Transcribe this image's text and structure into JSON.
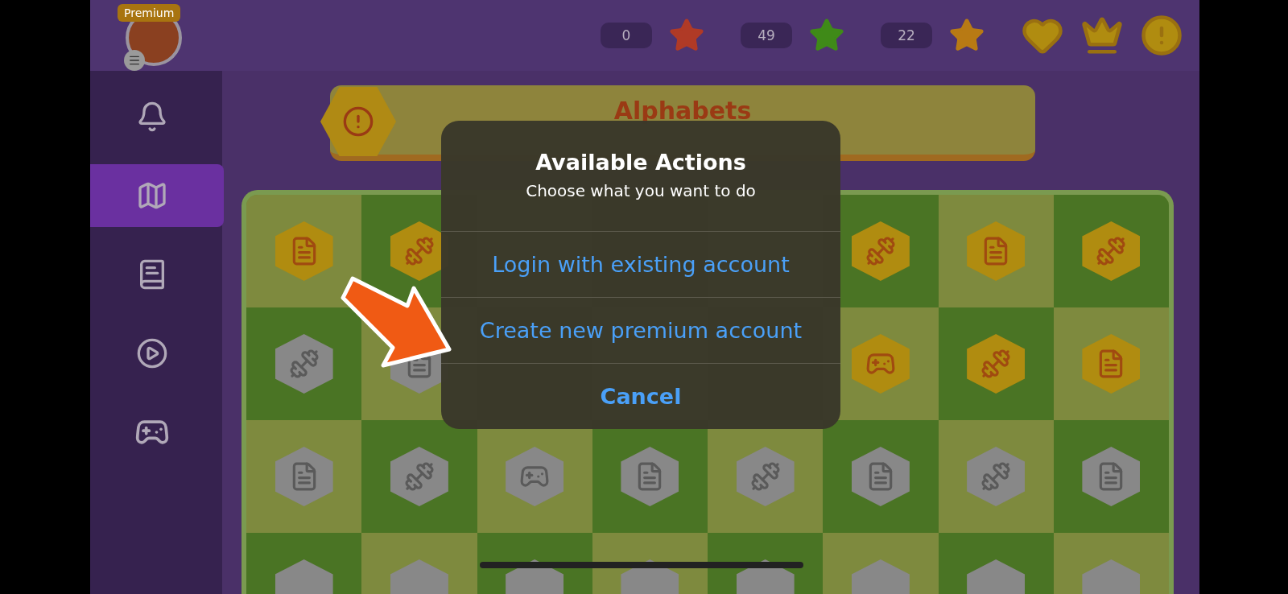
{
  "profile": {
    "badge": "Premium"
  },
  "stats": [
    {
      "count": "0",
      "color": "#b03a26"
    },
    {
      "count": "49",
      "color": "#3f8a18"
    },
    {
      "count": "22",
      "color": "#b87a14"
    }
  ],
  "sidebar": {
    "items": [
      {
        "kind": "bell",
        "selected": false
      },
      {
        "kind": "map",
        "selected": true
      },
      {
        "kind": "book",
        "selected": false
      },
      {
        "kind": "play",
        "selected": false
      },
      {
        "kind": "gamepad",
        "selected": false
      }
    ]
  },
  "banner": {
    "title": "Alphabets"
  },
  "map": {
    "rows": [
      [
        {
          "kind": "doc",
          "unlocked": true
        },
        {
          "kind": "dumbbell",
          "unlocked": true
        },
        null,
        null,
        null,
        {
          "kind": "dumbbell",
          "unlocked": true
        },
        {
          "kind": "doc",
          "unlocked": true
        },
        {
          "kind": "dumbbell",
          "unlocked": true
        }
      ],
      [
        {
          "kind": "dumbbell",
          "unlocked": false
        },
        {
          "kind": "doc",
          "unlocked": false
        },
        null,
        null,
        null,
        {
          "kind": "gamepad",
          "unlocked": true
        },
        {
          "kind": "dumbbell",
          "unlocked": true
        },
        {
          "kind": "doc",
          "unlocked": true
        }
      ],
      [
        {
          "kind": "doc",
          "unlocked": false
        },
        {
          "kind": "dumbbell",
          "unlocked": false
        },
        {
          "kind": "gamepad",
          "unlocked": false
        },
        {
          "kind": "doc",
          "unlocked": false
        },
        {
          "kind": "dumbbell",
          "unlocked": false
        },
        {
          "kind": "doc",
          "unlocked": false
        },
        {
          "kind": "dumbbell",
          "unlocked": false
        },
        {
          "kind": "doc",
          "unlocked": false
        }
      ]
    ]
  },
  "dialog": {
    "title": "Available Actions",
    "message": "Choose what you want to do",
    "actions": [
      {
        "label": "Login with existing account",
        "kind": "default"
      },
      {
        "label": "Create new premium account",
        "kind": "default"
      },
      {
        "label": "Cancel",
        "kind": "cancel"
      }
    ]
  }
}
